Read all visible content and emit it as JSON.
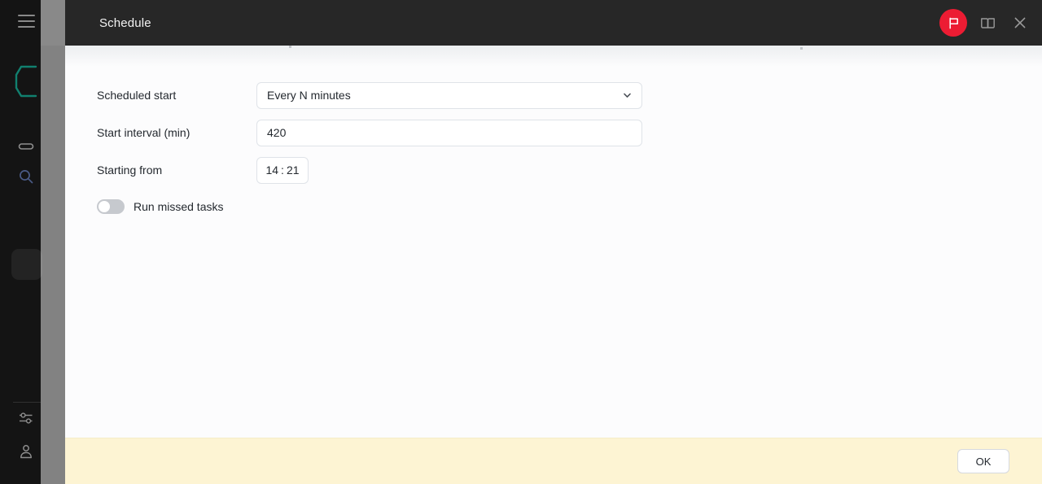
{
  "sidebar": {
    "menu_icon": "hamburger-icon",
    "logo": "app-logo",
    "items": [
      {
        "icon": "card-icon"
      },
      {
        "icon": "search-icon"
      },
      {
        "icon": "selected-item"
      },
      {
        "icon": "sliders-icon"
      },
      {
        "icon": "user-icon"
      }
    ]
  },
  "dialog": {
    "title": "Schedule",
    "header_actions": [
      {
        "name": "flag-button",
        "icon": "flag-icon"
      },
      {
        "name": "manual-button",
        "icon": "book-icon"
      },
      {
        "name": "close-button",
        "icon": "close-icon"
      }
    ],
    "form": {
      "scheduled_start": {
        "label": "Scheduled start",
        "value": "Every N minutes"
      },
      "start_interval": {
        "label": "Start interval (min)",
        "value": "420"
      },
      "starting_from": {
        "label": "Starting from",
        "hours": "14",
        "separator": ":",
        "minutes": "21"
      },
      "run_missed_tasks": {
        "label": "Run missed tasks",
        "enabled": "off"
      }
    },
    "footer": {
      "ok_label": "OK"
    }
  },
  "colors": {
    "header_bg": "#272727",
    "flag_accent": "#ec1c33",
    "footer_bg": "#fdf4d3",
    "logo_teal": "#11806f",
    "sidebar_bg": "#141414"
  }
}
